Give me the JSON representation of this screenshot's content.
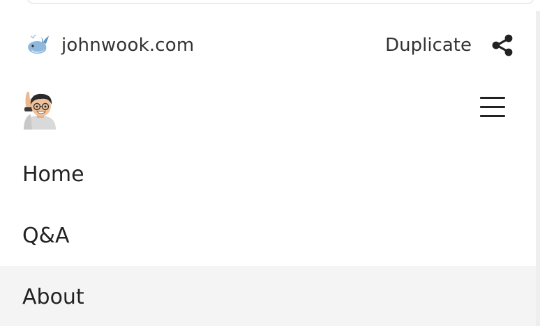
{
  "site_bar": {
    "favicon_icon": "whale-icon",
    "site_name": "johnwook.com",
    "duplicate_label": "Duplicate",
    "share_icon": "share-icon"
  },
  "header": {
    "avatar_icon": "memoji-waving-avatar",
    "menu_icon": "hamburger-menu-icon"
  },
  "nav": {
    "items": [
      {
        "label": "Home"
      },
      {
        "label": "Q&A"
      },
      {
        "label": "About",
        "active": true
      }
    ]
  },
  "colors": {
    "text": "#222222",
    "active_row_bg": "#f4f4f4",
    "background": "#ffffff"
  }
}
